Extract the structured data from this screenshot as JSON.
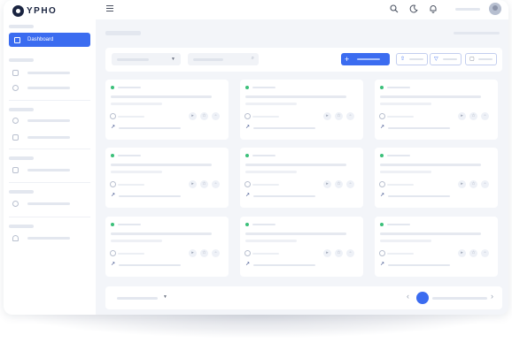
{
  "app": {
    "logo_text": "YPHO"
  },
  "sidebar": {
    "active_item": {
      "label": "Dashboard",
      "icon": "grid-icon"
    },
    "items": [
      {
        "icon": "layers-icon"
      },
      {
        "icon": "package-icon"
      },
      {
        "icon": "target-icon"
      },
      {
        "icon": "plus-square-icon"
      },
      {
        "icon": "calendar-icon"
      },
      {
        "icon": "pie-chart-icon"
      },
      {
        "icon": "user-icon"
      }
    ]
  },
  "topbar": {
    "icons": [
      "menu-icon",
      "search-icon",
      "moon-icon",
      "bell-icon"
    ]
  },
  "toolbar": {
    "add_button_icon": "+",
    "filter_select_caret": "▼",
    "search_glyph": "⌕"
  },
  "cards": [
    {
      "status": "active"
    },
    {
      "status": "active"
    },
    {
      "status": "active"
    },
    {
      "status": "active"
    },
    {
      "status": "active"
    },
    {
      "status": "active"
    },
    {
      "status": "active"
    },
    {
      "status": "active"
    },
    {
      "status": "active"
    }
  ],
  "pagination": {
    "prev_glyph": "‹",
    "next_glyph": "›",
    "per_page_caret": "▼"
  },
  "colors": {
    "accent": "#3b6cf0",
    "status_active": "#3cc07a",
    "background": "#f3f5f9"
  }
}
